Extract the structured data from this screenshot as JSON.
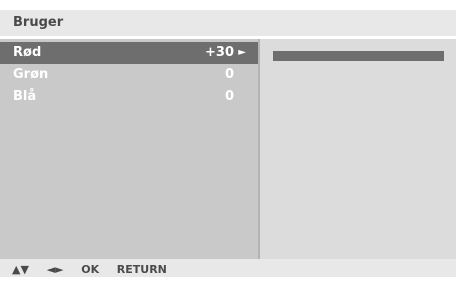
{
  "menu": {
    "title": "Bruger",
    "items": [
      {
        "label": "Rød",
        "value": "+30",
        "selected": true,
        "arrow": "►"
      },
      {
        "label": "Grøn",
        "value": "0",
        "selected": false
      },
      {
        "label": "Blå",
        "value": "0",
        "selected": false
      }
    ]
  },
  "level": {
    "fraction": 1.0
  },
  "navigation": {
    "up_down": "▲▼",
    "left_right": "◄►",
    "ok": "OK",
    "return": "RETURN"
  },
  "colors": {
    "panel_left": "#c9c9c9",
    "panel_right": "#dcdcdc",
    "highlight": "#6e6e6e",
    "bar_fill": "#6e6e6e",
    "title_bg": "#e8e8e8",
    "text_dark": "#4a4a4a",
    "text_light": "#ffffff"
  }
}
